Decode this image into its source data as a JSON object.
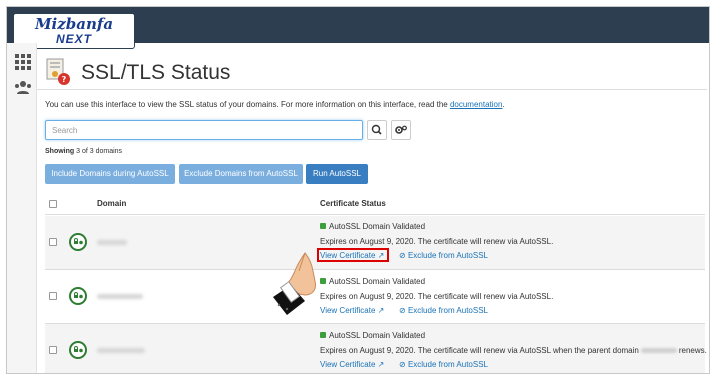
{
  "brand": {
    "line1": "Mizbanfa",
    "line2": "NEXT"
  },
  "page": {
    "title": "SSL/TLS Status",
    "intro_text": "You can use this interface to view the SSL status of your domains. For more information on this interface, read the ",
    "intro_link": "documentation",
    "intro_end": "."
  },
  "search": {
    "placeholder": "Search"
  },
  "showing": {
    "prefix": "Showing",
    "text": " 3 of 3 domains"
  },
  "buttons": {
    "include": "Include Domains during AutoSSL",
    "exclude": "Exclude Domains from AutoSSL",
    "run": "Run AutoSSL"
  },
  "table": {
    "col_domain": "Domain",
    "col_status": "Certificate Status",
    "rows": [
      {
        "status": "AutoSSL Domain Validated",
        "expires": "Expires on August 9, 2020. The certificate will renew via AutoSSL.",
        "view": "View Certificate",
        "exclude": "Exclude from AutoSSL"
      },
      {
        "status": "AutoSSL Domain Validated",
        "expires": "Expires on August 9, 2020. The certificate will renew via AutoSSL.",
        "view": "View Certificate",
        "exclude": "Exclude from AutoSSL"
      },
      {
        "status": "AutoSSL Domain Validated",
        "expires_a": "Expires on August 9, 2020. The certificate will renew via AutoSSL when the parent domain",
        "expires_b": "renews.",
        "view": "View Certificate",
        "exclude": "Exclude from AutoSSL"
      }
    ]
  },
  "colors": {
    "topbar": "#2c3e50",
    "link": "#1a73b8",
    "primary": "#3a7ec2",
    "success": "#2e7d32",
    "highlight": "#dd0000"
  }
}
